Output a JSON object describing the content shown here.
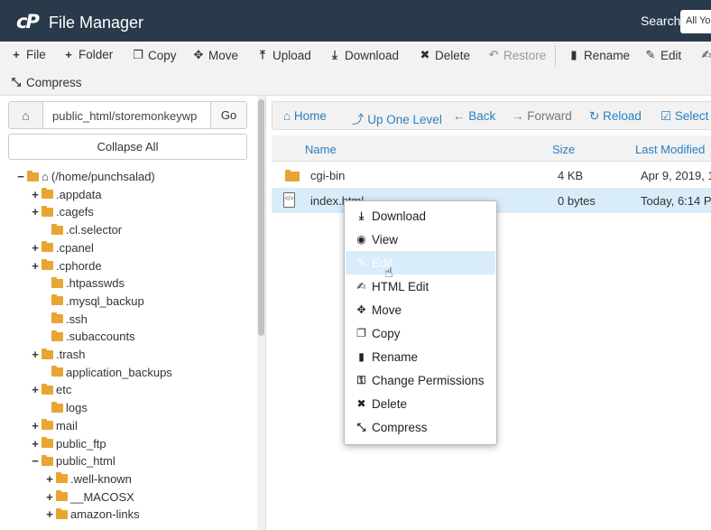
{
  "header": {
    "logo": "cP",
    "title": "File Manager",
    "search_label": "Search",
    "search_value": "All Yo"
  },
  "toolbar": {
    "row1": [
      {
        "icon": "plus",
        "glyph": "+",
        "label": "File"
      },
      {
        "icon": "plus",
        "glyph": "+",
        "label": "Folder"
      },
      {
        "icon": "copy",
        "glyph": "❐",
        "label": "Copy"
      },
      {
        "icon": "move",
        "glyph": "✥",
        "label": "Move"
      },
      {
        "icon": "upload",
        "glyph": "⤒",
        "label": "Upload"
      },
      {
        "icon": "download",
        "glyph": "⤓",
        "label": "Download"
      },
      {
        "icon": "delete",
        "glyph": "✖",
        "label": "Delete"
      },
      {
        "icon": "restore",
        "glyph": "↶",
        "label": "Restore"
      },
      {
        "icon": "rename",
        "glyph": "▮",
        "label": "Rename"
      },
      {
        "icon": "edit",
        "glyph": "✎",
        "label": "Edit"
      }
    ],
    "compress_label": "Compress"
  },
  "left": {
    "path_value": "public_html/storemonkeywp",
    "go_label": "Go",
    "collapse_label": "Collapse All",
    "tree": [
      {
        "toggle": "−",
        "label": "(/home/punchsalad)",
        "home": true
      },
      {
        "toggle": "+",
        "label": ".appdata"
      },
      {
        "toggle": "+",
        "label": ".cagefs"
      },
      {
        "toggle": "",
        "label": ".cl.selector"
      },
      {
        "toggle": "+",
        "label": ".cpanel"
      },
      {
        "toggle": "+",
        "label": ".cphorde"
      },
      {
        "toggle": "",
        "label": ".htpasswds"
      },
      {
        "toggle": "",
        "label": ".mysql_backup"
      },
      {
        "toggle": "",
        "label": ".ssh"
      },
      {
        "toggle": "",
        "label": ".subaccounts"
      },
      {
        "toggle": "+",
        "label": ".trash"
      },
      {
        "toggle": "",
        "label": "application_backups"
      },
      {
        "toggle": "+",
        "label": "etc"
      },
      {
        "toggle": "",
        "label": "logs"
      },
      {
        "toggle": "+",
        "label": "mail"
      },
      {
        "toggle": "+",
        "label": "public_ftp"
      },
      {
        "toggle": "−",
        "label": "public_html"
      },
      {
        "toggle": "+",
        "label": ".well-known"
      },
      {
        "toggle": "+",
        "label": "__MACOSX"
      },
      {
        "toggle": "+",
        "label": "amazon-links"
      }
    ]
  },
  "nav": {
    "home": "Home",
    "up": "Up One Level",
    "back": "Back",
    "forward": "Forward",
    "reload": "Reload",
    "select_all": "Select A"
  },
  "table": {
    "headers": {
      "name": "Name",
      "size": "Size",
      "modified": "Last Modified"
    },
    "rows": [
      {
        "name": "cgi-bin",
        "size": "4 KB",
        "modified": "Apr 9, 2019, 1"
      },
      {
        "name": "index.html",
        "size": "0 bytes",
        "modified": "Today, 6:14 P"
      }
    ]
  },
  "context_menu": [
    {
      "icon": "download",
      "glyph": "⤓",
      "label": "Download"
    },
    {
      "icon": "eye",
      "glyph": "◉",
      "label": "View"
    },
    {
      "icon": "pencil",
      "glyph": "✎",
      "label": "Edit"
    },
    {
      "icon": "html-edit",
      "glyph": "✍",
      "label": "HTML Edit"
    },
    {
      "icon": "move",
      "glyph": "✥",
      "label": "Move"
    },
    {
      "icon": "copy",
      "glyph": "❐",
      "label": "Copy"
    },
    {
      "icon": "rename",
      "glyph": "▮",
      "label": "Rename"
    },
    {
      "icon": "key",
      "glyph": "⚿",
      "label": "Change Permissions"
    },
    {
      "icon": "delete",
      "glyph": "✖",
      "label": "Delete"
    },
    {
      "icon": "compress",
      "glyph": "⤡",
      "label": "Compress"
    }
  ]
}
